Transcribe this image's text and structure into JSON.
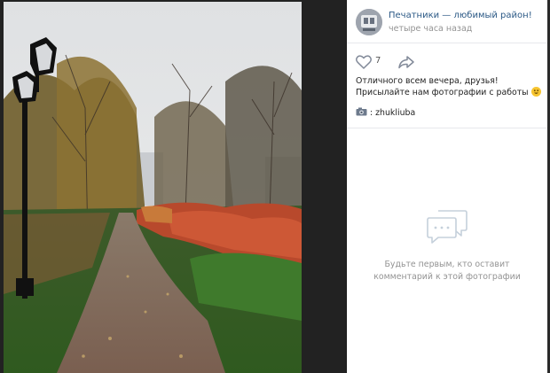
{
  "post": {
    "group_name": "Печатники — любимый район!",
    "time": "четыре часа назад",
    "likes": "7",
    "caption": "Отличного всем вечера, друзья! Присылайте нам фотографии с работы",
    "author": ": zhukliuba"
  },
  "comments": {
    "empty_line1": "Будьте первым, кто оставит",
    "empty_line2": "комментарий к этой фотографии"
  },
  "icons": {
    "like": "heart-icon",
    "share": "share-arrow-icon",
    "emoji": "smiling-emoji-icon",
    "camera": "camera-icon",
    "comments": "speech-bubble-icon"
  },
  "colors": {
    "link": "#2a5885",
    "muted": "#939393",
    "background_dark": "#1a1a1a"
  }
}
